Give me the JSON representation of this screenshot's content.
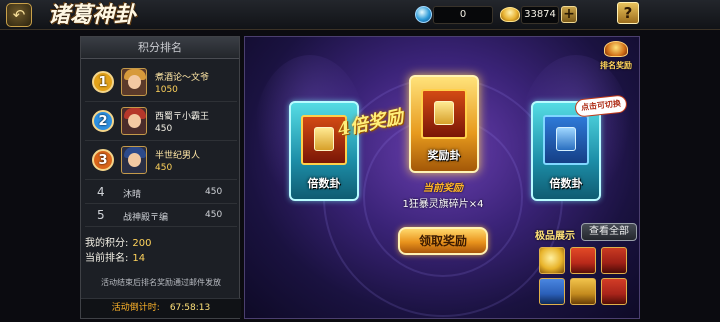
{
  "header": {
    "back_icon": "back-arrow-icon",
    "title": "诸葛神卦",
    "gem_amount": "0",
    "gold_amount": "33874",
    "plus_label": "+",
    "help_label": "?"
  },
  "ranking": {
    "title": "积分排名",
    "top": [
      {
        "rank": "1",
        "name": "煮酒论〜文爷",
        "score": "1050",
        "medal_color": "#e3a21a",
        "hair_color": "#d79a3b"
      },
      {
        "rank": "2",
        "name": "西蜀〒小霸王",
        "score": "450",
        "medal_color": "#2c8fe0",
        "hair_color": "#b5372a"
      },
      {
        "rank": "3",
        "name": "半世纪男人",
        "score": "450",
        "medal_color": "#d9651a",
        "hair_color": "#2d4a8a"
      }
    ],
    "others": [
      {
        "rank": "4",
        "name": "沐晴",
        "score": "450"
      },
      {
        "rank": "5",
        "name": "战神殿〒编",
        "score": "450"
      }
    ],
    "my_score_label": "我的积分:",
    "my_score": "200",
    "my_rank_label": "当前排名:",
    "my_rank": "14",
    "note": "活动结束后排名奖励通过邮件发放",
    "countdown_label": "活动倒计时:",
    "countdown_value": "67:58:13"
  },
  "stage": {
    "left_card_label": "倍数卦",
    "center_card_label": "奖励卦",
    "right_card_label": "倍数卦",
    "multiplier_text": "4倍奖励",
    "reward_title": "当前奖励",
    "reward_item": "1狂暴灵旗碎片×4",
    "claim_button": "领取奖励",
    "rank_reward_label": "排名奖励",
    "bubble_text": "点击可切换",
    "showcase_label": "极品展示",
    "view_all_button": "查看全部",
    "thumbnails": [
      {
        "name": "gold-coin-thumb",
        "color": "#e8b32a"
      },
      {
        "name": "red-armor-thumb",
        "color": "#b9291a"
      },
      {
        "name": "red-robe-thumb",
        "color": "#9d1f16"
      },
      {
        "name": "blue-flag-thumb",
        "color": "#2a5fb8"
      },
      {
        "name": "gold-weapon-thumb",
        "color": "#c48b1e"
      },
      {
        "name": "red-helmet-thumb",
        "color": "#a8241a"
      }
    ]
  }
}
